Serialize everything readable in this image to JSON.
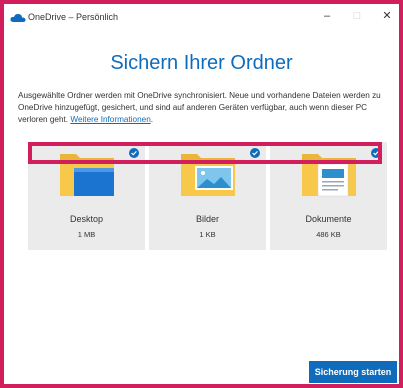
{
  "window": {
    "title": "OneDrive – Persönlich",
    "min_glyph": "–",
    "max_glyph": "□",
    "close_glyph": "✕"
  },
  "heading": "Sichern Ihrer Ordner",
  "description": {
    "text": "Ausgewählte Ordner werden mit OneDrive synchronisiert. Neue und vorhandene Dateien werden zu OneDrive hinzugefügt, gesichert, und sind auf anderen Geräten verfügbar, auch wenn dieser PC verloren geht.",
    "link": "Weitere Informationen",
    "period": "."
  },
  "folders": [
    {
      "name": "Desktop",
      "size": "1 MB",
      "selected": true,
      "icon": "desktop-folder-icon"
    },
    {
      "name": "Bilder",
      "size": "1 KB",
      "selected": true,
      "icon": "pictures-folder-icon"
    },
    {
      "name": "Dokumente",
      "size": "486 KB",
      "selected": true,
      "icon": "documents-folder-icon"
    }
  ],
  "start_button": "Sicherung starten",
  "colors": {
    "accent": "#0f6cbd",
    "highlight_border": "#d11f5e",
    "tile_bg": "#ebebeb",
    "folder_yellow": "#f8c84a"
  }
}
